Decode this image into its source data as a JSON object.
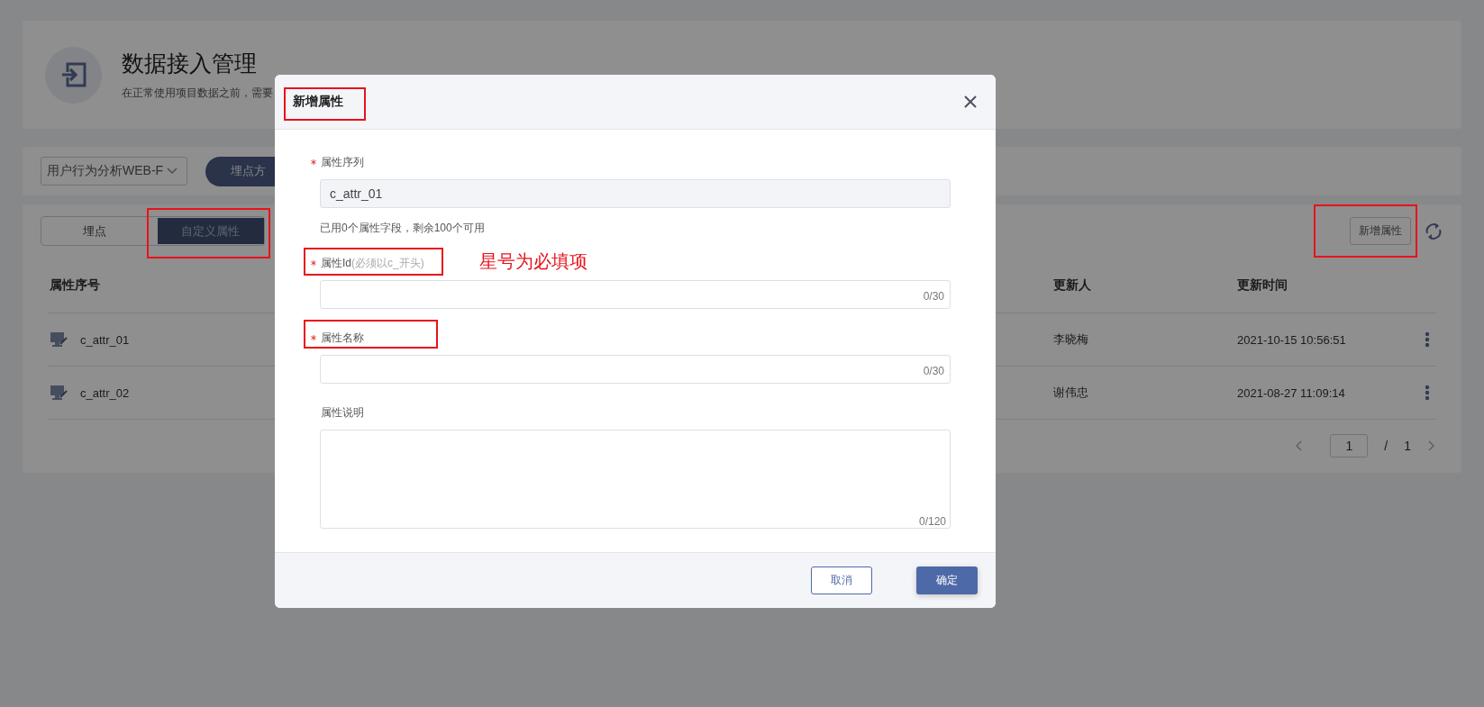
{
  "header": {
    "title": "数据接入管理",
    "subtitle": "在正常使用项目数据之前，需要"
  },
  "toolbar": {
    "project_select": "用户行为分析WEB-F",
    "plan_button": "埋点方"
  },
  "tabs": [
    {
      "label": "埋点",
      "selected": false
    },
    {
      "label": "自定义属性",
      "selected": true
    }
  ],
  "add_button": "新增属性",
  "table": {
    "columns": [
      "属性序号",
      "更新人",
      "更新时间"
    ],
    "rows": [
      {
        "cells": [
          "c_attr_01",
          "李晓梅",
          "2021-10-15 10:56:51"
        ]
      },
      {
        "cells": [
          "c_attr_02",
          "谢伟忠",
          "2021-08-27 11:09:14"
        ]
      }
    ]
  },
  "pagination": {
    "page": "1",
    "separator": "/",
    "total": "1"
  },
  "dialog": {
    "title": "新增属性",
    "fields": [
      {
        "kind": "input",
        "label": "属性序列",
        "required": true,
        "value": "c_attr_01",
        "disabled": true,
        "help": "已用0个属性字段，剩余100个可用"
      },
      {
        "kind": "input",
        "label": "属性Id",
        "hint": "(必须以c_开头)",
        "required": true,
        "counter": "0/30",
        "disabled": false
      },
      {
        "kind": "input",
        "label": "属性名称",
        "required": true,
        "counter": "0/30",
        "disabled": false
      },
      {
        "kind": "textarea",
        "label": "属性说明",
        "required": false,
        "counter": "0/120",
        "disabled": false
      }
    ],
    "cancel": "取消",
    "ok": "确定"
  },
  "annotation": {
    "text": "星号为必填项"
  }
}
